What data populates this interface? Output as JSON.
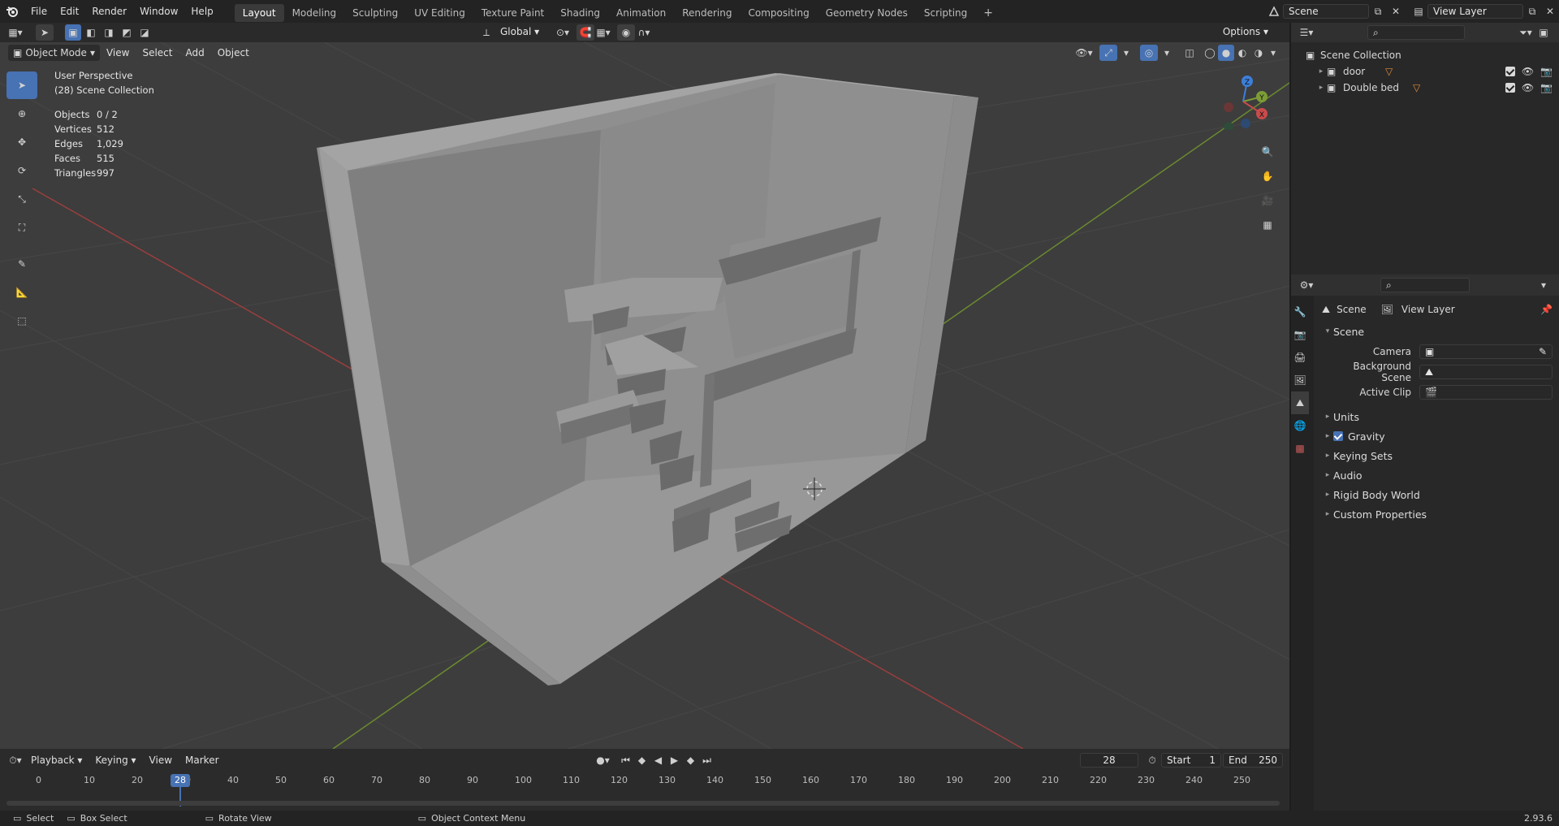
{
  "app": {
    "menu": [
      "File",
      "Edit",
      "Render",
      "Window",
      "Help"
    ],
    "workspaces": [
      "Layout",
      "Modeling",
      "Sculpting",
      "UV Editing",
      "Texture Paint",
      "Shading",
      "Animation",
      "Rendering",
      "Compositing",
      "Geometry Nodes",
      "Scripting"
    ],
    "active_workspace": "Layout",
    "add_tab": "+",
    "scene_name": "Scene",
    "view_layer_name": "View Layer"
  },
  "viewport": {
    "mode": "Object Mode",
    "menus": [
      "View",
      "Select",
      "Add",
      "Object"
    ],
    "transform_orientation": "Global",
    "options_label": "Options",
    "overlay_title": "User Perspective",
    "overlay_collection": "(28) Scene Collection",
    "stats": [
      {
        "label": "Objects",
        "value": "0 / 2"
      },
      {
        "label": "Vertices",
        "value": "512"
      },
      {
        "label": "Edges",
        "value": "1,029"
      },
      {
        "label": "Faces",
        "value": "515"
      },
      {
        "label": "Triangles",
        "value": "997"
      }
    ],
    "gizmo_axes": {
      "x": "X",
      "y": "Y",
      "z": "Z"
    },
    "colors": {
      "x_axis": "#c94b4b",
      "y_axis": "#7c9d36",
      "z_axis": "#3d7fd9",
      "active_tool": "#4772b3"
    }
  },
  "outliner": {
    "root": "Scene Collection",
    "items": [
      {
        "name": "door"
      },
      {
        "name": "Double bed"
      }
    ]
  },
  "properties": {
    "breadcrumb_scene": "Scene",
    "breadcrumb_view_layer": "View Layer",
    "panel_title": "Scene",
    "fields": [
      {
        "label": "Camera",
        "value": ""
      },
      {
        "label": "Background Scene",
        "value": ""
      },
      {
        "label": "Active Clip",
        "value": ""
      }
    ],
    "sections": [
      "Units",
      "Gravity",
      "Keying Sets",
      "Audio",
      "Rigid Body World",
      "Custom Properties"
    ],
    "gravity_checked": true
  },
  "timeline": {
    "menus": [
      "Playback",
      "Keying",
      "View",
      "Marker"
    ],
    "current_frame": "28",
    "start_label": "Start",
    "start_value": "1",
    "end_label": "End",
    "end_value": "250",
    "ticks": [
      "0",
      "10",
      "20",
      "30",
      "40",
      "50",
      "60",
      "70",
      "80",
      "90",
      "100",
      "110",
      "120",
      "130",
      "140",
      "150",
      "160",
      "170",
      "180",
      "190",
      "200",
      "210",
      "220",
      "230",
      "240",
      "250"
    ],
    "playhead_label": "28"
  },
  "statusbar": {
    "select": "Select",
    "box_select": "Box Select",
    "rotate_view": "Rotate View",
    "context_menu": "Object Context Menu",
    "version": "2.93.6"
  }
}
